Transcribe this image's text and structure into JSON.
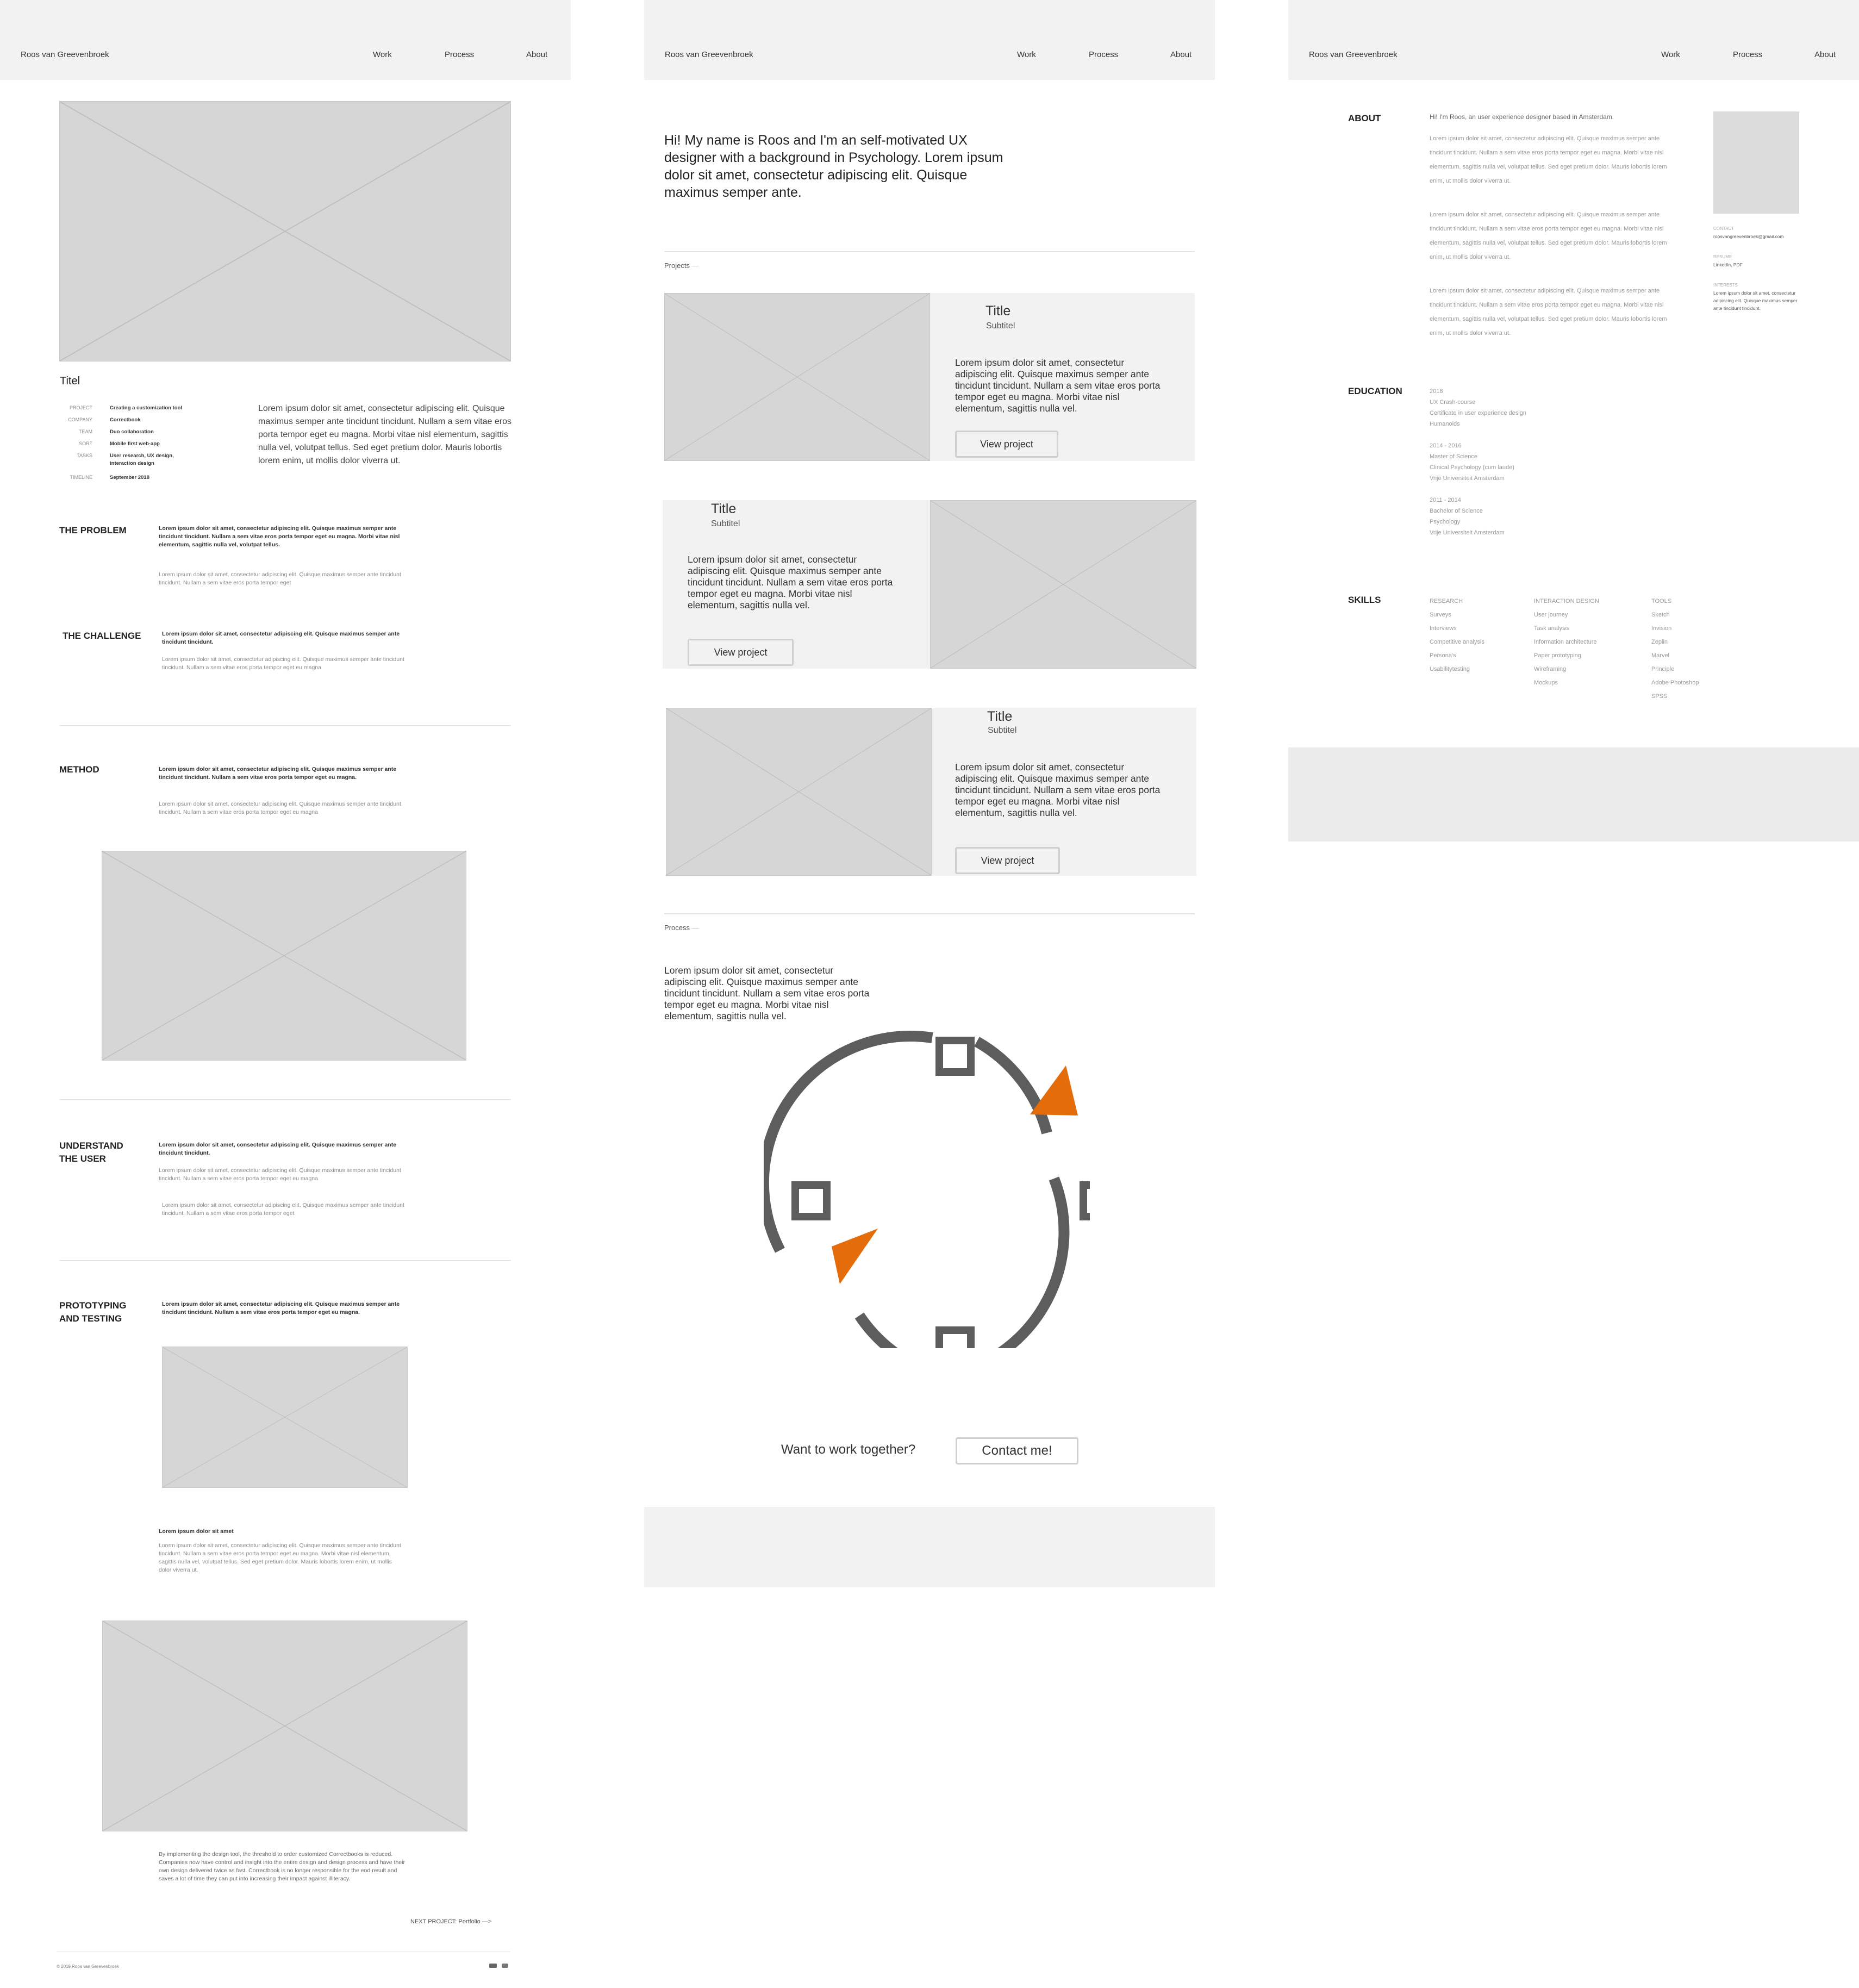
{
  "header": {
    "brand": "Roos van Greevenbroek",
    "nav": {
      "work": "Work",
      "process": "Process",
      "about": "About"
    }
  },
  "project_page": {
    "title": "Titel",
    "meta": [
      {
        "key": "PROJECT",
        "value": "Creating a customization tool"
      },
      {
        "key": "COMPANY",
        "value": "Correctbook"
      },
      {
        "key": "TEAM",
        "value": "Duo collaboration"
      },
      {
        "key": "SORT",
        "value": "Mobile first web-app"
      },
      {
        "key": "TASKS",
        "value": "User research, UX design, interaction design"
      },
      {
        "key": "TIMELINE",
        "value": "September 2018"
      }
    ],
    "intro": "Lorem ipsum dolor sit amet, consectetur adipiscing elit. Quisque maximus semper ante tincidunt tincidunt. Nullam a sem vitae eros porta tempor eget eu magna. Morbi vitae nisl elementum, sagittis nulla vel, volutpat tellus. Sed eget pretium dolor. Mauris lobortis lorem enim, ut mollis dolor viverra ut.",
    "sections": {
      "problem": {
        "heading": "THE PROBLEM",
        "bold": "Lorem ipsum dolor sit amet, consectetur adipiscing elit. Quisque maximus semper ante tincidunt tincidunt. Nullam a sem vitae eros porta tempor eget eu magna. Morbi vitae nisl elementum, sagittis nulla vel, volutpat tellus.",
        "text": "Lorem ipsum dolor sit amet, consectetur adipiscing elit. Quisque maximus semper ante tincidunt tincidunt. Nullam a sem vitae eros porta tempor eget"
      },
      "challenge": {
        "heading": "THE CHALLENGE",
        "bold": "Lorem ipsum dolor sit amet, consectetur adipiscing elit. Quisque maximus semper ante tincidunt tincidunt.",
        "text": "Lorem ipsum dolor sit amet, consectetur adipiscing elit. Quisque maximus semper ante tincidunt tincidunt. Nullam a sem vitae eros porta tempor eget eu magna"
      },
      "method": {
        "heading": "METHOD",
        "bold": "Lorem ipsum dolor sit amet, consectetur adipiscing elit. Quisque maximus semper ante tincidunt tincidunt. Nullam a sem vitae eros porta tempor eget eu magna.",
        "text": "Lorem ipsum dolor sit amet, consectetur adipiscing elit. Quisque maximus semper ante tincidunt tincidunt. Nullam a sem vitae eros porta tempor eget eu magna"
      },
      "understand": {
        "heading1": "UNDERSTAND",
        "heading2": "THE USER",
        "bold": "Lorem ipsum dolor sit amet, consectetur adipiscing elit. Quisque maximus semper ante tincidunt tincidunt.",
        "text1": "Lorem ipsum dolor sit amet, consectetur adipiscing elit. Quisque maximus semper ante tincidunt tincidunt. Nullam a sem vitae eros porta tempor eget eu magna",
        "text2": "Lorem ipsum dolor sit amet, consectetur adipiscing elit. Quisque maximus semper ante tincidunt tincidunt. Nullam a sem vitae eros porta tempor eget"
      },
      "prototyping": {
        "heading1": "PROTOTYPING",
        "heading2": "AND TESTING",
        "bold": "Lorem ipsum dolor sit amet, consectetur adipiscing elit. Quisque maximus semper ante tincidunt tincidunt. Nullam a sem vitae eros porta tempor eget eu magna.",
        "subhead": "Lorem ipsum dolor sit amet",
        "text": "Lorem ipsum dolor sit amet, consectetur adipiscing elit. Quisque maximus semper ante tincidunt tincidunt. Nullam a sem vitae eros porta tempor eget eu magna. Morbi vitae nisl elementum, sagittis nulla vel, volutpat tellus. Sed eget pretium dolor. Mauris lobortis lorem enim, ut mollis dolor viverra ut."
      }
    },
    "conclusion": "By implementing the design tool, the threshold to order customized Correctbooks is reduced. Companies now have control and insight into the entire design and design process and have their own design delivered twice as fast. Correctbook is no longer responsible for the end result and saves a lot of time they can put into increasing their impact against illiteracy.",
    "next_project": "NEXT PROJECT: Portfolio —>",
    "footer_copy": "© 2019 Roos van Greevenbroek"
  },
  "home_page": {
    "intro": "Hi! My name is Roos and I'm an self-motivated UX designer with a background in Psychology. Lorem ipsum dolor sit amet, consectetur adipiscing elit. Quisque maximus semper ante.",
    "projects_label": "Projects",
    "projects_dash": "—",
    "cards": [
      {
        "title": "Title",
        "subtitle": "Subtitel",
        "body": "Lorem ipsum dolor sit amet, consectetur adipiscing elit. Quisque maximus semper ante tincidunt tincidunt. Nullam a sem vitae eros porta tempor eget eu magna. Morbi vitae nisl elementum, sagittis nulla vel.",
        "button": "View project"
      },
      {
        "title": "Title",
        "subtitle": "Subtitel",
        "body": "Lorem ipsum dolor sit amet, consectetur adipiscing elit. Quisque maximus semper ante tincidunt tincidunt. Nullam a sem vitae eros porta tempor eget eu magna. Morbi vitae nisl elementum, sagittis nulla vel.",
        "button": "View project"
      },
      {
        "title": "Title",
        "subtitle": "Subtitel",
        "body": "Lorem ipsum dolor sit amet, consectetur adipiscing elit. Quisque maximus semper ante tincidunt tincidunt. Nullam a sem vitae eros porta tempor eget eu magna. Morbi vitae nisl elementum, sagittis nulla vel.",
        "button": "View project"
      }
    ],
    "process_label": "Process",
    "process_dash": "—",
    "process_text": "Lorem ipsum dolor sit amet, consectetur adipiscing elit. Quisque maximus semper ante tincidunt tincidunt. Nullam a sem vitae eros porta tempor eget eu magna. Morbi vitae nisl elementum, sagittis nulla vel.",
    "cta_text": "Want to work together?",
    "cta_button": "Contact me!",
    "colors": {
      "arrow": "#e46c0a",
      "cycle": "#5d5d5d"
    }
  },
  "about_page": {
    "about_heading": "ABOUT",
    "about_lead": "Hi! I'm Roos, an user experience designer based in Amsterdam.",
    "about_paras": [
      "Lorem ipsum dolor sit amet, consectetur adipiscing elit. Quisque maximus semper ante tincidunt tincidunt. Nullam a sem vitae eros porta tempor eget eu magna. Morbi vitae nisl elementum, sagittis nulla vel, volutpat tellus. Sed eget pretium dolor. Mauris lobortis lorem enim, ut mollis dolor viverra ut.",
      "Lorem ipsum dolor sit amet, consectetur adipiscing elit. Quisque maximus semper ante tincidunt tincidunt. Nullam a sem vitae eros porta tempor eget eu magna. Morbi vitae nisl elementum, sagittis nulla vel, volutpat tellus. Sed eget pretium dolor. Mauris lobortis lorem enim, ut mollis dolor viverra ut.",
      "Lorem ipsum dolor sit amet, consectetur adipiscing elit. Quisque maximus semper ante tincidunt tincidunt. Nullam a sem vitae eros porta tempor eget eu magna. Morbi vitae nisl elementum, sagittis nulla vel, volutpat tellus. Sed eget pretium dolor. Mauris lobortis lorem enim, ut mollis dolor viverra ut."
    ],
    "side": {
      "contact_label": "CONTACT",
      "contact_value": "roosvangreevenbroek@gmail.com",
      "resume_label": "RESUME",
      "resume_value": "LinkedIn, PDF",
      "interests_label": "INTERESTS",
      "interests_value": "Lorem ipsum dolor sit amet, consectetur adipiscing elit. Quisque maximus semper ante tincidunt tincidunt."
    },
    "education_heading": "EDUCATION",
    "education": [
      {
        "years": "2018",
        "lines": [
          "UX Crash-course",
          "Certificate in user experience design",
          "Humanoids"
        ]
      },
      {
        "years": "2014 - 2016",
        "lines": [
          "Master of Science",
          "Clinical Psychology (cum laude)",
          "Vrije Universiteit Amsterdam"
        ]
      },
      {
        "years": "2011 - 2014",
        "lines": [
          "Bachelor of Science",
          "Psychology",
          "Vrije Universiteit Amsterdam"
        ]
      }
    ],
    "skills_heading": "SKILLS",
    "skills": [
      {
        "heading": "RESEARCH",
        "items": [
          "Surveys",
          "Interviews",
          "Competitive analysis",
          "Persona's",
          "Usabilitytesting"
        ]
      },
      {
        "heading": "INTERACTION DESIGN",
        "items": [
          "User journey",
          "Task analysis",
          "Information architecture",
          "Paper prototyping",
          "Wireframing",
          "Mockups"
        ]
      },
      {
        "heading": "TOOLS",
        "items": [
          "Sketch",
          "Invision",
          "Zeplin",
          "Marvel",
          "Principle",
          "Adobe Photoshop",
          "SPSS"
        ]
      }
    ]
  }
}
